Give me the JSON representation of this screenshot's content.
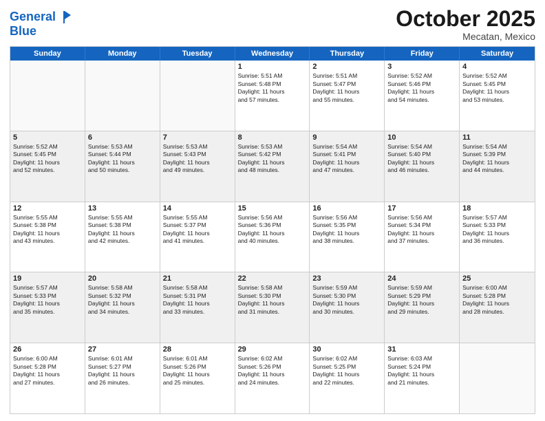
{
  "header": {
    "logo_line1": "General",
    "logo_line2": "Blue",
    "month": "October 2025",
    "location": "Mecatan, Mexico"
  },
  "days_of_week": [
    "Sunday",
    "Monday",
    "Tuesday",
    "Wednesday",
    "Thursday",
    "Friday",
    "Saturday"
  ],
  "weeks": [
    [
      {
        "day": "",
        "info": ""
      },
      {
        "day": "",
        "info": ""
      },
      {
        "day": "",
        "info": ""
      },
      {
        "day": "1",
        "info": "Sunrise: 5:51 AM\nSunset: 5:48 PM\nDaylight: 11 hours\nand 57 minutes."
      },
      {
        "day": "2",
        "info": "Sunrise: 5:51 AM\nSunset: 5:47 PM\nDaylight: 11 hours\nand 55 minutes."
      },
      {
        "day": "3",
        "info": "Sunrise: 5:52 AM\nSunset: 5:46 PM\nDaylight: 11 hours\nand 54 minutes."
      },
      {
        "day": "4",
        "info": "Sunrise: 5:52 AM\nSunset: 5:45 PM\nDaylight: 11 hours\nand 53 minutes."
      }
    ],
    [
      {
        "day": "5",
        "info": "Sunrise: 5:52 AM\nSunset: 5:45 PM\nDaylight: 11 hours\nand 52 minutes."
      },
      {
        "day": "6",
        "info": "Sunrise: 5:53 AM\nSunset: 5:44 PM\nDaylight: 11 hours\nand 50 minutes."
      },
      {
        "day": "7",
        "info": "Sunrise: 5:53 AM\nSunset: 5:43 PM\nDaylight: 11 hours\nand 49 minutes."
      },
      {
        "day": "8",
        "info": "Sunrise: 5:53 AM\nSunset: 5:42 PM\nDaylight: 11 hours\nand 48 minutes."
      },
      {
        "day": "9",
        "info": "Sunrise: 5:54 AM\nSunset: 5:41 PM\nDaylight: 11 hours\nand 47 minutes."
      },
      {
        "day": "10",
        "info": "Sunrise: 5:54 AM\nSunset: 5:40 PM\nDaylight: 11 hours\nand 46 minutes."
      },
      {
        "day": "11",
        "info": "Sunrise: 5:54 AM\nSunset: 5:39 PM\nDaylight: 11 hours\nand 44 minutes."
      }
    ],
    [
      {
        "day": "12",
        "info": "Sunrise: 5:55 AM\nSunset: 5:38 PM\nDaylight: 11 hours\nand 43 minutes."
      },
      {
        "day": "13",
        "info": "Sunrise: 5:55 AM\nSunset: 5:38 PM\nDaylight: 11 hours\nand 42 minutes."
      },
      {
        "day": "14",
        "info": "Sunrise: 5:55 AM\nSunset: 5:37 PM\nDaylight: 11 hours\nand 41 minutes."
      },
      {
        "day": "15",
        "info": "Sunrise: 5:56 AM\nSunset: 5:36 PM\nDaylight: 11 hours\nand 40 minutes."
      },
      {
        "day": "16",
        "info": "Sunrise: 5:56 AM\nSunset: 5:35 PM\nDaylight: 11 hours\nand 38 minutes."
      },
      {
        "day": "17",
        "info": "Sunrise: 5:56 AM\nSunset: 5:34 PM\nDaylight: 11 hours\nand 37 minutes."
      },
      {
        "day": "18",
        "info": "Sunrise: 5:57 AM\nSunset: 5:33 PM\nDaylight: 11 hours\nand 36 minutes."
      }
    ],
    [
      {
        "day": "19",
        "info": "Sunrise: 5:57 AM\nSunset: 5:33 PM\nDaylight: 11 hours\nand 35 minutes."
      },
      {
        "day": "20",
        "info": "Sunrise: 5:58 AM\nSunset: 5:32 PM\nDaylight: 11 hours\nand 34 minutes."
      },
      {
        "day": "21",
        "info": "Sunrise: 5:58 AM\nSunset: 5:31 PM\nDaylight: 11 hours\nand 33 minutes."
      },
      {
        "day": "22",
        "info": "Sunrise: 5:58 AM\nSunset: 5:30 PM\nDaylight: 11 hours\nand 31 minutes."
      },
      {
        "day": "23",
        "info": "Sunrise: 5:59 AM\nSunset: 5:30 PM\nDaylight: 11 hours\nand 30 minutes."
      },
      {
        "day": "24",
        "info": "Sunrise: 5:59 AM\nSunset: 5:29 PM\nDaylight: 11 hours\nand 29 minutes."
      },
      {
        "day": "25",
        "info": "Sunrise: 6:00 AM\nSunset: 5:28 PM\nDaylight: 11 hours\nand 28 minutes."
      }
    ],
    [
      {
        "day": "26",
        "info": "Sunrise: 6:00 AM\nSunset: 5:28 PM\nDaylight: 11 hours\nand 27 minutes."
      },
      {
        "day": "27",
        "info": "Sunrise: 6:01 AM\nSunset: 5:27 PM\nDaylight: 11 hours\nand 26 minutes."
      },
      {
        "day": "28",
        "info": "Sunrise: 6:01 AM\nSunset: 5:26 PM\nDaylight: 11 hours\nand 25 minutes."
      },
      {
        "day": "29",
        "info": "Sunrise: 6:02 AM\nSunset: 5:26 PM\nDaylight: 11 hours\nand 24 minutes."
      },
      {
        "day": "30",
        "info": "Sunrise: 6:02 AM\nSunset: 5:25 PM\nDaylight: 11 hours\nand 22 minutes."
      },
      {
        "day": "31",
        "info": "Sunrise: 6:03 AM\nSunset: 5:24 PM\nDaylight: 11 hours\nand 21 minutes."
      },
      {
        "day": "",
        "info": ""
      }
    ]
  ]
}
